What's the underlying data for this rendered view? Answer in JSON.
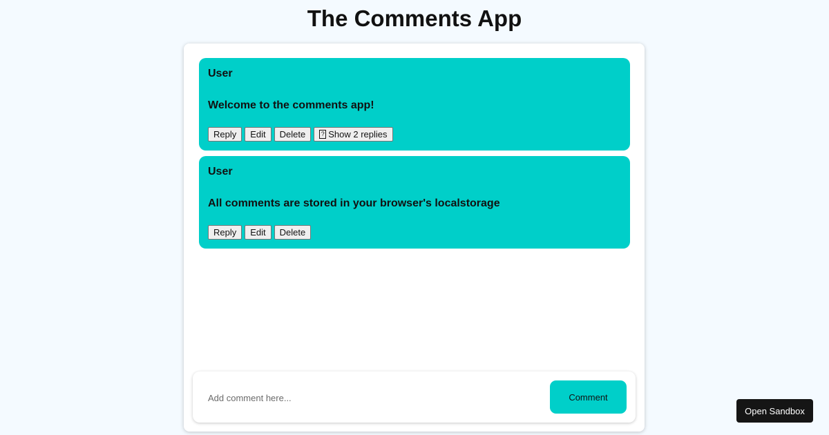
{
  "page": {
    "title": "The Comments App"
  },
  "comments": [
    {
      "author": "User",
      "text": "Welcome to the comments app!",
      "reply_label": "Reply",
      "edit_label": "Edit",
      "delete_label": "Delete",
      "toggle_label": "Show 2 replies",
      "toggle_icon": "chevron-toggle-icon"
    },
    {
      "author": "User",
      "text": "All comments are stored in your browser's localstorage",
      "reply_label": "Reply",
      "edit_label": "Edit",
      "delete_label": "Delete"
    }
  ],
  "composer": {
    "placeholder": "Add comment here...",
    "value": "",
    "submit_label": "Comment"
  },
  "sandbox": {
    "label": "Open Sandbox"
  },
  "colors": {
    "page_background": "#f4faff",
    "accent": "#00cfc9",
    "panel_background": "#ffffff",
    "sandbox_button": "#151515"
  }
}
